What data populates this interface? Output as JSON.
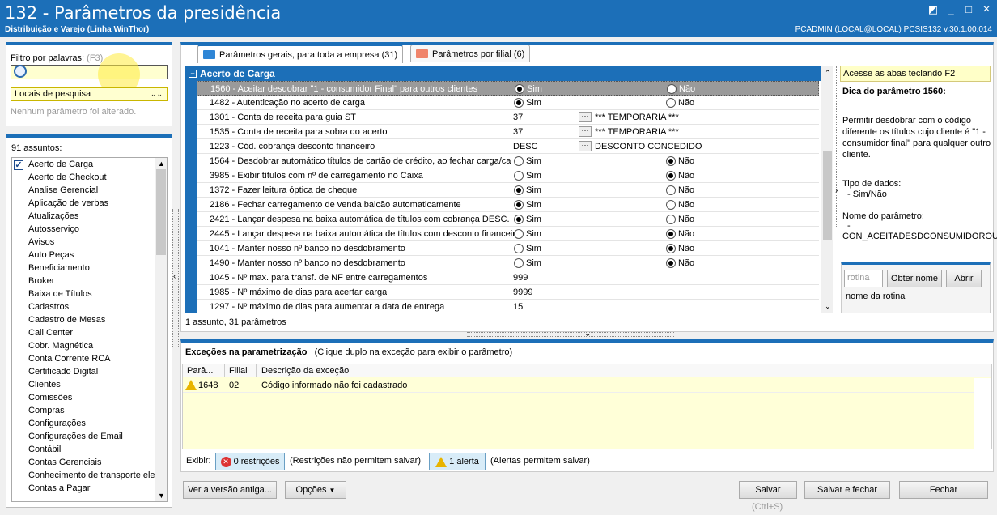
{
  "window": {
    "title": "132 - Parâmetros da presidência",
    "subtitle": "Distribuição e Varejo (Linha WinThor)",
    "user_info": "PCADMIN (LOCAL@LOCAL)   PCSIS132  v.30.1.00.014",
    "controls": [
      "◩",
      "_",
      "□",
      "×"
    ]
  },
  "filter": {
    "label": "Filtro por palavras:",
    "shortcut": "(F3)",
    "search_value": "",
    "locais_label": "Locais de pesquisa",
    "status": "Nenhum parâmetro foi alterado."
  },
  "subjects": {
    "count_label": "91 assuntos:",
    "items": [
      "Acerto de Carga",
      "Acerto de Checkout",
      "Analise Gerencial",
      "Aplicação de verbas",
      "Atualizações",
      "Autosserviço",
      "Avisos",
      "Auto Peças",
      "Beneficiamento",
      "Broker",
      "Baixa de Títulos",
      "Cadastros",
      "Cadastro de Mesas",
      "Call Center",
      "Cobr. Magnética",
      "Conta Corrente RCA",
      "Certificado Digital",
      "Clientes",
      "Comissões",
      "Compras",
      "Configurações",
      "Configurações de Email",
      "Contábil",
      "Contas Gerenciais",
      "Conhecimento de transporte ele",
      "Contas a Pagar"
    ]
  },
  "tabs": [
    {
      "label": "Parâmetros gerais, para toda a empresa",
      "count": "(31)"
    },
    {
      "label": "Parâmetros por filial",
      "count": "(6)"
    }
  ],
  "grid": {
    "group_title": "Acerto de Carga",
    "footer": "1 assunto, 31 parâmetros",
    "sim": "Sim",
    "nao": "Não",
    "rows": [
      {
        "name": "1560 - Aceitar desdobrar \"1 - consumidor Final\" para outros clientes",
        "type": "radio",
        "value": "sim"
      },
      {
        "name": "1482 - Autenticação no acerto de carga",
        "type": "radio",
        "value": "sim"
      },
      {
        "name": "1301 - Conta de receita para guia ST",
        "type": "lookup",
        "code": "37",
        "desc": "*** TEMPORARIA ***"
      },
      {
        "name": "1535 - Conta de receita para sobra do acerto",
        "type": "lookup",
        "code": "37",
        "desc": "*** TEMPORARIA ***"
      },
      {
        "name": "1223 - Cód. cobrança desconto financeiro",
        "type": "lookup",
        "code": "DESC",
        "desc": "DESCONTO CONCEDIDO"
      },
      {
        "name": "1564 - Desdobrar automático títulos de cartão de crédito, ao fechar carga/ca",
        "type": "radio",
        "value": "nao"
      },
      {
        "name": "3985 - Exibir títulos com nº de carregamento no Caixa",
        "type": "radio",
        "value": "nao"
      },
      {
        "name": "1372 - Fazer leitura óptica de cheque",
        "type": "radio",
        "value": "sim"
      },
      {
        "name": "2186 - Fechar carregamento de venda balcão automaticamente",
        "type": "radio",
        "value": "sim"
      },
      {
        "name": "2421 - Lançar despesa na baixa automática de títulos com cobrança DESC.",
        "type": "radio",
        "value": "sim"
      },
      {
        "name": "2445 - Lançar despesa na baixa automática de títulos com desconto financeir",
        "type": "radio",
        "value": "nao"
      },
      {
        "name": "1041 - Manter nosso nº banco no desdobramento",
        "type": "radio",
        "value": "nao"
      },
      {
        "name": "1490 - Manter nosso nº banco no desdobramento",
        "type": "radio",
        "value": "nao"
      },
      {
        "name": "1045 - Nº max. para transf. de NF entre carregamentos",
        "type": "value",
        "code": "999"
      },
      {
        "name": "1985 - Nº máximo de dias para acertar carga",
        "type": "value",
        "code": "9999"
      },
      {
        "name": "1297 - Nº máximo de dias para aumentar a data de entrega",
        "type": "value",
        "code": "15"
      }
    ]
  },
  "hint": {
    "top": "Acesse as abas teclando F2",
    "title": "Dica do parâmetro 1560:",
    "text": "Permitir desdobrar com o código diferente os títulos cujo cliente é \"1 - consumidor final\" para qualquer outro cliente.",
    "type_label": "Tipo de dados:",
    "type_value": "- Sim/Não",
    "name_label": "Nome do parâmetro:",
    "name_dash": "-",
    "name_value": "CON_ACEITADESDCONSUMIDOROUT"
  },
  "rotina": {
    "placeholder": "rotina",
    "obter": "Obter nome",
    "abrir": "Abrir",
    "nome": "nome da rotina"
  },
  "exceptions": {
    "title": "Exceções na parametrização",
    "subtitle": "(Clique duplo na exceção para exibir o parâmetro)",
    "cols": [
      "Parâ...",
      "Filial",
      "Descrição da exceção"
    ],
    "rows": [
      {
        "param": "1648",
        "filial": "02",
        "desc": "Código informado não foi cadastrado"
      }
    ]
  },
  "exibir": {
    "label": "Exibir:",
    "restr_btn": "0 restrições",
    "restr_note": "(Restrições não permitem salvar)",
    "alert_btn": "1 alerta",
    "alert_note": "(Alertas permitem salvar)"
  },
  "footer": {
    "versao": "Ver a versão antiga...",
    "opcoes": "Opções",
    "salvar": "Salvar",
    "salvar_shortcut": "(Ctrl+S)",
    "salvar_fechar": "Salvar e fechar",
    "fechar": "Fechar"
  }
}
